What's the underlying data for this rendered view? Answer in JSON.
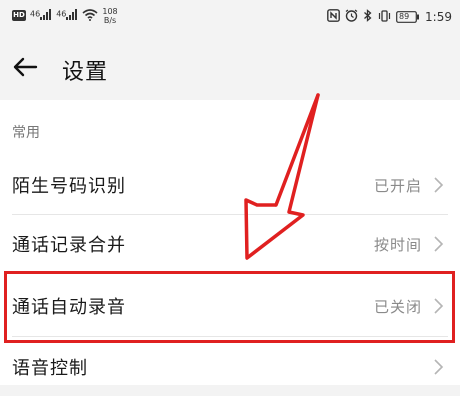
{
  "status_bar": {
    "hd": "HD",
    "signal1": "46",
    "signal2": "46",
    "speed_value": "108",
    "speed_unit": "B/s",
    "battery": "89",
    "time": "1:59"
  },
  "header": {
    "back_icon": "arrow-left-icon",
    "title": "设置"
  },
  "section": {
    "label": "常用"
  },
  "rows": [
    {
      "label": "陌生号码识别",
      "value": "已开启"
    },
    {
      "label": "通话记录合并",
      "value": "按时间"
    },
    {
      "label": "通话自动录音",
      "value": "已关闭"
    },
    {
      "label": "语音控制",
      "value": ""
    }
  ],
  "annotation": {
    "arrow_color": "#e02020",
    "highlight_color": "#e02020"
  }
}
